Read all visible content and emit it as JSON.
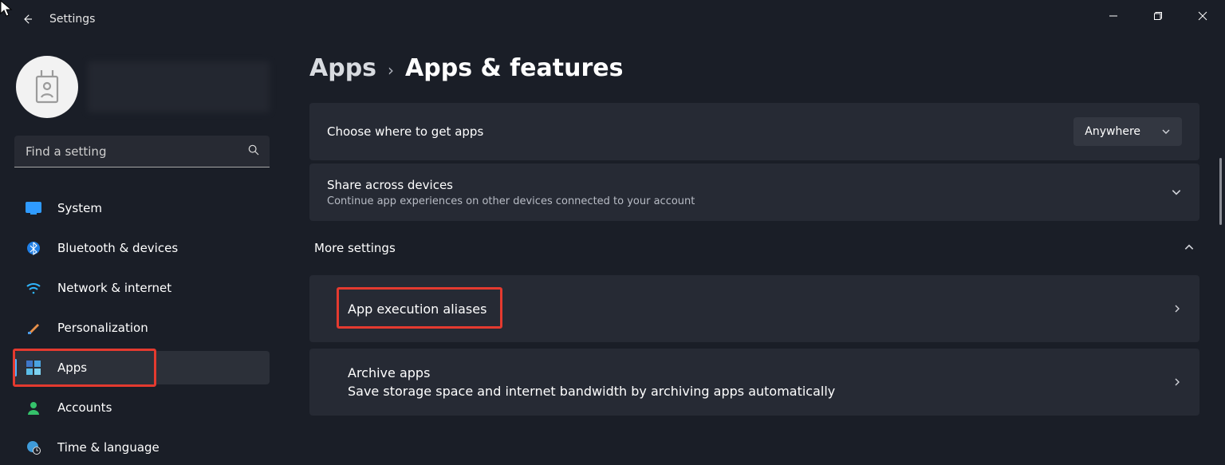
{
  "window": {
    "title": "Settings"
  },
  "search": {
    "placeholder": "Find a setting"
  },
  "sidebar": {
    "items": [
      {
        "id": "system",
        "label": "System"
      },
      {
        "id": "bluetooth",
        "label": "Bluetooth & devices"
      },
      {
        "id": "network",
        "label": "Network & internet"
      },
      {
        "id": "personalization",
        "label": "Personalization"
      },
      {
        "id": "apps",
        "label": "Apps"
      },
      {
        "id": "accounts",
        "label": "Accounts"
      },
      {
        "id": "time-language",
        "label": "Time & language"
      }
    ]
  },
  "breadcrumb": {
    "parent": "Apps",
    "current": "Apps & features"
  },
  "cards": {
    "getApps": {
      "title": "Choose where to get apps",
      "value": "Anywhere"
    },
    "share": {
      "title": "Share across devices",
      "sub": "Continue app experiences on other devices connected to your account"
    },
    "moreSettings": "More settings",
    "alias": {
      "title": "App execution aliases"
    },
    "archive": {
      "title": "Archive apps",
      "sub": "Save storage space and internet bandwidth by archiving apps automatically"
    }
  }
}
